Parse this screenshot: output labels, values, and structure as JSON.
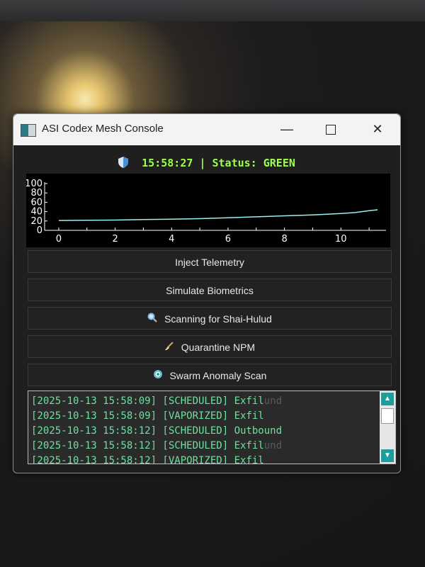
{
  "window": {
    "title": "ASI Codex Mesh Console",
    "controls": {
      "minimize": "—",
      "close": "✕"
    }
  },
  "status": {
    "time": "15:58:27",
    "separator": "|",
    "label": "Status:",
    "value": "GREEN",
    "color": "#9cff4a"
  },
  "chart_data": {
    "type": "line",
    "x": [
      0,
      1,
      2,
      3,
      4,
      5,
      6,
      7,
      8,
      9,
      10,
      10.5,
      11,
      11.3
    ],
    "series": [
      {
        "values": [
          21,
          21.5,
          22,
          23,
          24,
          25,
          27,
          29,
          31,
          33,
          36,
          38,
          42,
          44
        ]
      }
    ],
    "xticks": [
      "0",
      "2",
      "4",
      "6",
      "8",
      "10"
    ],
    "yticks": [
      "0",
      "20",
      "40",
      "60",
      "80",
      "100"
    ],
    "xlim": [
      -0.5,
      11.6
    ],
    "ylim": [
      0,
      100
    ],
    "line_color": "#9af0ee",
    "background": "#000000"
  },
  "buttons": [
    {
      "icon": "",
      "label": "Inject Telemetry"
    },
    {
      "icon": "",
      "label": "Simulate Biometrics"
    },
    {
      "icon": "search-icon",
      "label": "Scanning for Shai-Hulud"
    },
    {
      "icon": "broom-icon",
      "label": "Quarantine NPM"
    },
    {
      "icon": "target-icon",
      "label": "Swarm Anomaly Scan"
    }
  ],
  "log": {
    "lines": [
      {
        "text": "[2025-10-13 15:58:09] [SCHEDULED] Exfil",
        "ghost": "und"
      },
      {
        "text": "[2025-10-13 15:58:09] [VAPORIZED] Exfil",
        "ghost": ""
      },
      {
        "text": "[2025-10-13 15:58:12] [SCHEDULED] Outbound",
        "ghost": ""
      },
      {
        "text": "[2025-10-13 15:58:12] [SCHEDULED] Exfil",
        "ghost": "und"
      },
      {
        "text": "[2025-10-13 15:58:12] [VAPORIZED] Exfil",
        "ghost": ""
      }
    ]
  }
}
